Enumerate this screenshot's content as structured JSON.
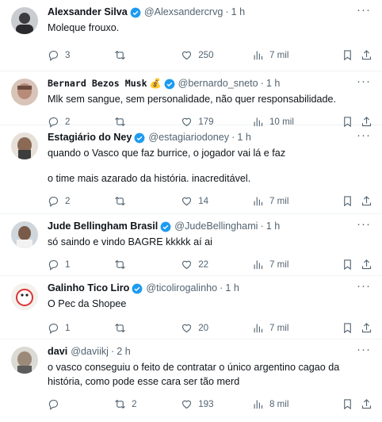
{
  "tweets": [
    {
      "name": "Alexsander Silva",
      "handle": "@Alexsandercrvg",
      "time": "1 h",
      "text": "Moleque frouxo.",
      "text2": "",
      "replies": "3",
      "retweets": "",
      "likes": "250",
      "views": "7 mil"
    },
    {
      "name": "Bernard Bezos Musk",
      "emoji": "💰",
      "handle": "@bernardo_sneto",
      "time": "1 h",
      "text": "Mlk sem sangue, sem personalidade, não quer responsabilidade.",
      "text2": "",
      "replies": "2",
      "retweets": "",
      "likes": "179",
      "views": "10 mil"
    },
    {
      "name": "Estagiário do Ney",
      "handle": "@estagiariodoney",
      "time": "1 h",
      "text": "quando o Vasco que faz burrice, o jogador vai lá e faz",
      "text2": "o time mais azarado da história. inacreditável.",
      "replies": "2",
      "retweets": "",
      "likes": "14",
      "views": "7 mil"
    },
    {
      "name": "Jude Bellingham Brasil",
      "handle": "@JudeBellinghami",
      "time": "1 h",
      "text": "só saindo e vindo BAGRE kkkkk aí ai",
      "text2": "",
      "replies": "1",
      "retweets": "",
      "likes": "22",
      "views": "7 mil"
    },
    {
      "name": "Galinho Tico Liro",
      "handle": "@ticolirogalinho",
      "time": "1 h",
      "text": "O Pec da Shopee",
      "text2": "",
      "replies": "1",
      "retweets": "",
      "likes": "20",
      "views": "7 mil"
    },
    {
      "name": "davi",
      "handle": "@daviikj",
      "time": "2 h",
      "text": "o vasco conseguiu o feito de contratar o único argentino cagao da história, como pode esse cara ser tão merd",
      "text2": "",
      "replies": "",
      "retweets": "2",
      "likes": "193",
      "views": "8 mil"
    }
  ],
  "separator": "·",
  "colors": {
    "verified": "#1d9bf0",
    "muted": "#536471",
    "text": "#0f1419",
    "border": "#eff3f4"
  },
  "icons": [
    "reply-icon",
    "retweet-icon",
    "like-icon",
    "views-icon",
    "bookmark-icon",
    "share-icon",
    "more-icon",
    "verified-badge-icon"
  ]
}
